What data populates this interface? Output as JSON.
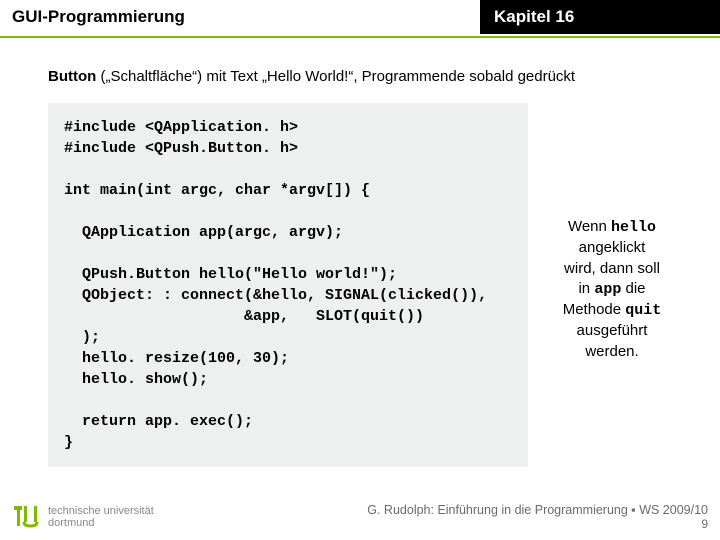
{
  "header": {
    "left": "GUI-Programmierung",
    "right": "Kapitel 16"
  },
  "intro": {
    "bold": "Button",
    "rest": " („Schaltfläche“) mit Text „Hello World!“, Programmende sobald gedrückt"
  },
  "code": "#include <QApplication. h>\n#include <QPush.Button. h>\n\nint main(int argc, char *argv[]) {\n\n  QApplication app(argc, argv);\n\n  QPush.Button hello(\"Hello world!\");\n  QObject: : connect(&hello, SIGNAL(clicked()),\n                    &app,   SLOT(quit())\n  );\n  hello. resize(100, 30);\n  hello. show();\n\n  return app. exec();\n}",
  "note": {
    "l1a": "Wenn ",
    "l1b": "hello",
    "l2": "angeklickt",
    "l3": "wird, dann soll",
    "l4a": "in ",
    "l4b": "app",
    "l4c": " die",
    "l5a": "Methode ",
    "l5b": "quit",
    "l6": "ausgeführt",
    "l7": "werden."
  },
  "footer": {
    "uni1": "technische universität",
    "uni2": "dortmund",
    "credit": "G. Rudolph: Einführung in die Programmierung ▪ WS 2009/10",
    "page": "9"
  }
}
